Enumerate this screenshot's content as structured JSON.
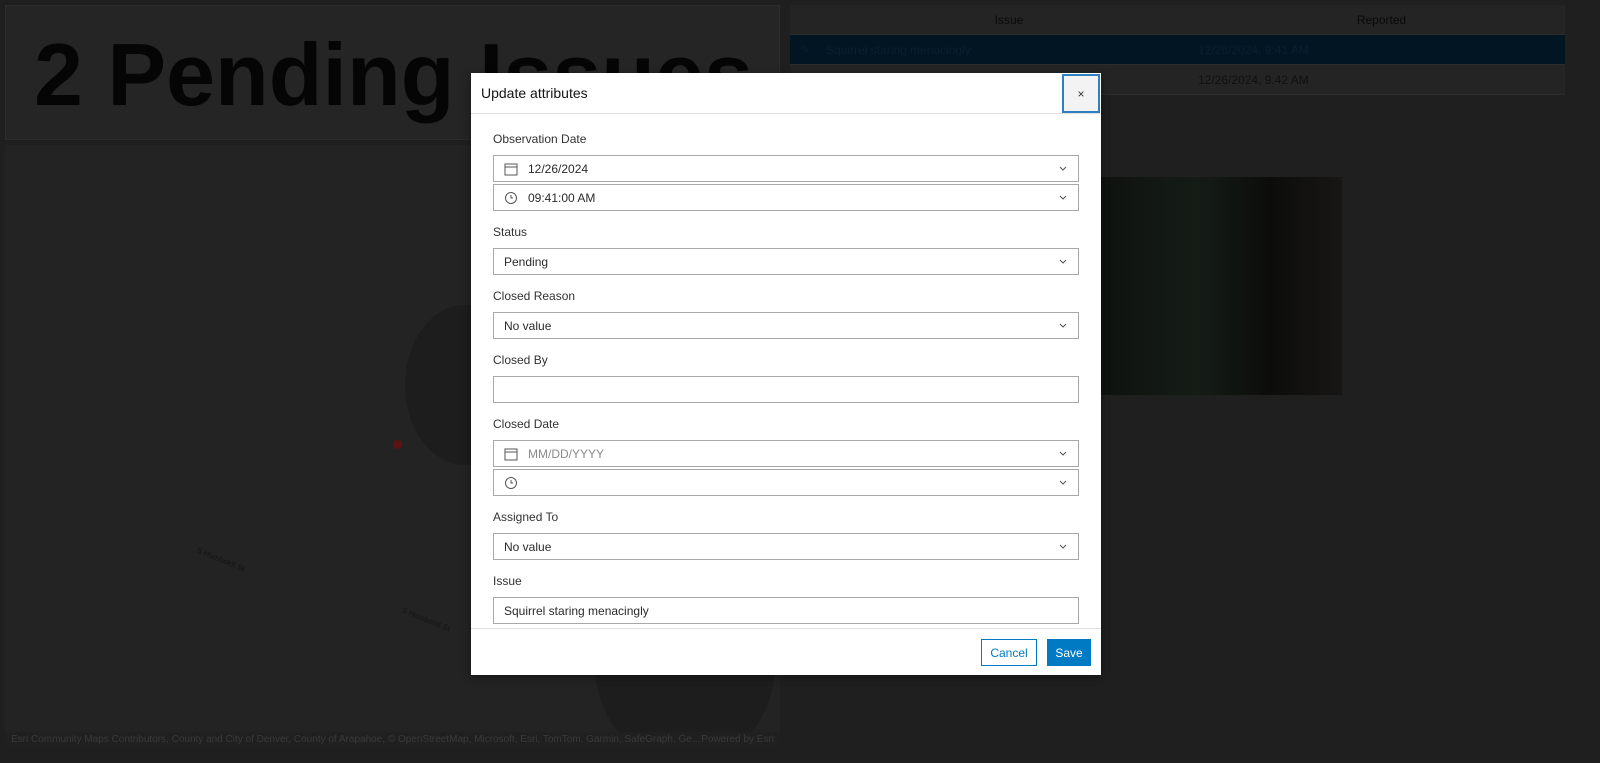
{
  "header": {
    "title": "2 Pending Issues"
  },
  "map": {
    "streets": [
      "S Humboldt St",
      "S Humboldt St"
    ],
    "attribution": "Esri Community Maps Contributors, County and City of Denver, County of Arapahoe, © OpenStreetMap, Microsoft, Esri, TomTom, Garmin, SafeGraph, Ge...",
    "powered_by": "Powered by Esri"
  },
  "table": {
    "columns": [
      "Issue",
      "Reported"
    ],
    "rows": [
      {
        "issue": "Squirrel staring menacingly",
        "reported": "12/26/2024, 9:41 AM"
      },
      {
        "issue": "",
        "reported": "12/26/2024, 9:42 AM"
      }
    ]
  },
  "dialog": {
    "title": "Update attributes",
    "close": "×",
    "observation_date": {
      "label": "Observation Date",
      "date": "12/26/2024",
      "time": "09:41:00 AM"
    },
    "status": {
      "label": "Status",
      "value": "Pending"
    },
    "closed_reason": {
      "label": "Closed Reason",
      "value": "No value"
    },
    "closed_by": {
      "label": "Closed By",
      "value": ""
    },
    "closed_date": {
      "label": "Closed Date",
      "date_placeholder": "MM/DD/YYYY",
      "time": ""
    },
    "assigned_to": {
      "label": "Assigned To",
      "value": "No value"
    },
    "issue": {
      "label": "Issue",
      "value": "Squirrel staring menacingly"
    },
    "cancel": "Cancel",
    "save": "Save"
  }
}
